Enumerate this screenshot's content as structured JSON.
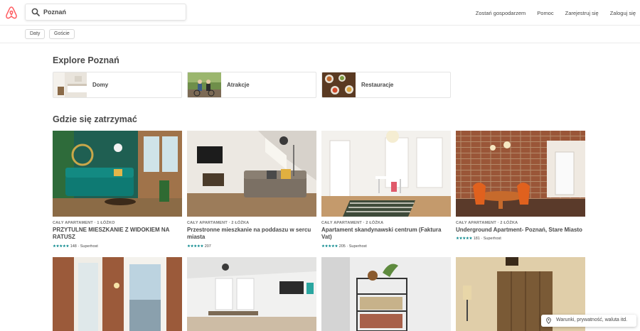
{
  "search": {
    "value": "Poznań"
  },
  "nav": [
    "Zostań gospodarzem",
    "Pomoc",
    "Zarejestruj się",
    "Zaloguj się"
  ],
  "filters": [
    "Daty",
    "Goście"
  ],
  "explore": {
    "heading": "Explore Poznań",
    "cards": [
      "Domy",
      "Atrakcje",
      "Restauracje"
    ]
  },
  "stay": {
    "heading": "Gdzie się zatrzymać",
    "listings": [
      {
        "meta": "CAŁY APARTAMENT · 1 ŁÓŻKO",
        "title": "PRZYTULNE MIESZKANIE Z WIDOKIEM NA RATUSZ",
        "stars": "★★★★★",
        "reviews": "148 · Superhost"
      },
      {
        "meta": "CAŁY APARTAMENT · 2 ŁÓŻKA",
        "title": "Przestronne mieszkanie na poddaszu w sercu miasta",
        "stars": "★★★★★",
        "reviews": "207"
      },
      {
        "meta": "CAŁY APARTAMENT · 2 ŁÓŻKA",
        "title": "Apartament skandynawski centrum (Faktura Vat)",
        "stars": "★★★★★",
        "reviews": "205 · Superhost"
      },
      {
        "meta": "CAŁY APARTAMENT · 2 ŁÓŻKA",
        "title": "Underground Apartment- Poznań, Stare Miasto",
        "stars": "★★★★★",
        "reviews": "181 · Superhost"
      }
    ]
  },
  "footer": {
    "label": "Warunki, prywatność, waluta itd."
  },
  "colors": {
    "brand": "#FF5A5F",
    "star": "#008489",
    "text": "#484848"
  }
}
